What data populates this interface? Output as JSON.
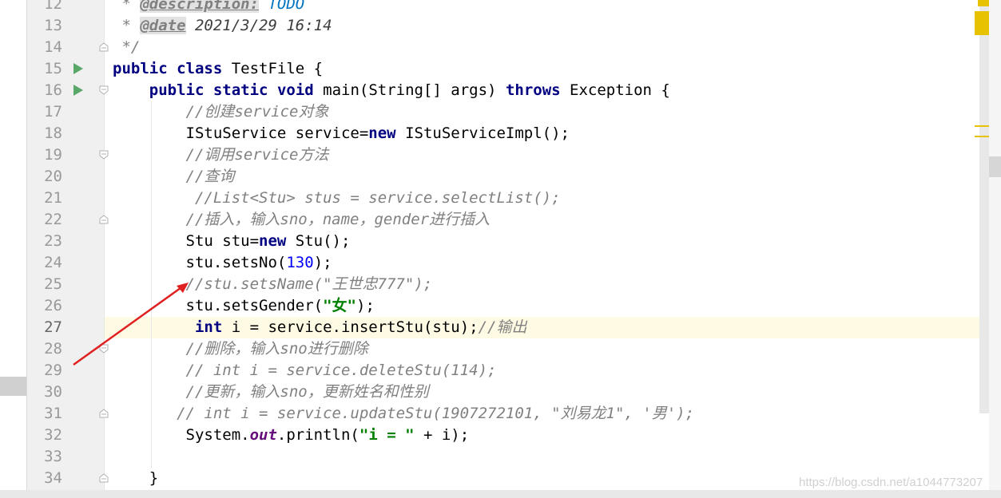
{
  "editor": {
    "line_numbers": [
      "12",
      "13",
      "14",
      "15",
      "16",
      "17",
      "18",
      "19",
      "20",
      "21",
      "22",
      "23",
      "24",
      "25",
      "26",
      "27",
      "28",
      "29",
      "30",
      "31",
      "32",
      "33",
      "34"
    ],
    "current_line": "27",
    "lines": {
      "l12": {
        "prefix": " * ",
        "tag": "@description:",
        "rest": " TODO"
      },
      "l13": {
        "prefix": " * ",
        "tag": "@date",
        "rest": " 2021/3/29 16:14"
      },
      "l14": {
        "text": " */"
      },
      "l15": {
        "kw1": "public",
        "kw2": "class",
        "rest": " TestFile {"
      },
      "l16": {
        "indent": "    ",
        "kw1": "public",
        "kw2": "static",
        "kw3": "void",
        "mid": " main(String[] args) ",
        "kw4": "throws",
        "rest": " Exception {"
      },
      "l17": {
        "indent": "        ",
        "comment": "//创建service对象"
      },
      "l18": {
        "indent": "        ",
        "a": "IStuService service=",
        "kw": "new",
        "b": " IStuServiceImpl();"
      },
      "l19": {
        "indent": "        ",
        "comment": "//调用service方法"
      },
      "l20": {
        "indent": "        ",
        "comment": "//查询"
      },
      "l21": {
        "indent": "         ",
        "comment": "//List<Stu> stus = service.selectList();"
      },
      "l22": {
        "indent": "        ",
        "comment": "//插入，输入sno，name，gender进行插入"
      },
      "l23": {
        "indent": "        ",
        "a": "Stu stu=",
        "kw": "new",
        "b": " Stu();"
      },
      "l24": {
        "indent": "        ",
        "a": "stu.setsNo(",
        "num": "130",
        "b": ");"
      },
      "l25": {
        "indent": "        ",
        "comment": "//stu.setsName(\"王世忠777\");"
      },
      "l26": {
        "indent": "        ",
        "a": "stu.setsGender(",
        "str": "\"女\"",
        "b": ");"
      },
      "l27": {
        "indent": "         ",
        "kw": "int",
        "a": " i = service.insertStu(stu);",
        "comment": "//输出"
      },
      "l28": {
        "indent": "        ",
        "comment": "//删除，输入sno进行删除"
      },
      "l29": {
        "indent": "        ",
        "comment": "// int i = service.deleteStu(114);"
      },
      "l30": {
        "indent": "        ",
        "comment": "//更新，输入sno，更新姓名和性别"
      },
      "l31": {
        "indent": "       ",
        "comment": "// int i = service.updateStu(1907272101, \"刘易龙1\", '男');"
      },
      "l32": {
        "indent": "        ",
        "a": "System.",
        "field": "out",
        "b": ".println(",
        "str": "\"i = \"",
        "c": " + i);"
      },
      "l33": {
        "text": ""
      },
      "l34": {
        "text": "    }"
      }
    }
  },
  "watermark": "https://blog.csdn.net/a1044773207",
  "colors": {
    "keyword": "#000080",
    "comment": "#808080",
    "string": "#008000",
    "number": "#0000ff",
    "run_icon": "#59a869",
    "annotation_arrow": "#e02020",
    "current_line_bg": "#fffae3",
    "scroll_marker": "#e6c200"
  }
}
